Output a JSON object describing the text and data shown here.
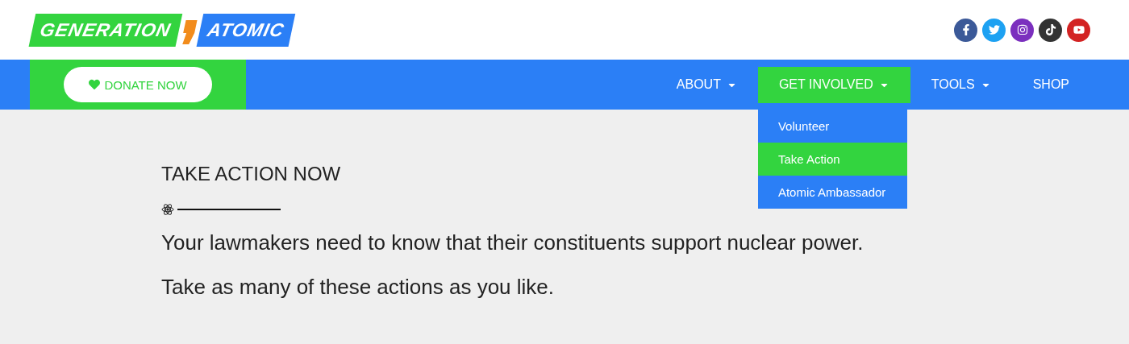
{
  "logo": {
    "left": "GENERATION",
    "right": "ATOMIC"
  },
  "social": [
    {
      "kind": "facebook",
      "color": "#3b5998"
    },
    {
      "kind": "twitter",
      "color": "#1da1f2"
    },
    {
      "kind": "instagram",
      "color": "#7b2fbe"
    },
    {
      "kind": "tiktok",
      "color": "#333333"
    },
    {
      "kind": "youtube",
      "color": "#d32323"
    }
  ],
  "donate": {
    "label": "DONATE NOW"
  },
  "nav": [
    {
      "label": "ABOUT",
      "dropdown": true,
      "selected": false
    },
    {
      "label": "GET INVOLVED",
      "dropdown": true,
      "selected": true,
      "expanded": true,
      "children": [
        {
          "label": "Volunteer",
          "selected": false
        },
        {
          "label": "Take Action",
          "selected": true
        },
        {
          "label": "Atomic Ambassador",
          "selected": false
        }
      ]
    },
    {
      "label": "TOOLS",
      "dropdown": true,
      "selected": false
    },
    {
      "label": "SHOP",
      "dropdown": false,
      "selected": false
    }
  ],
  "section": {
    "heading": "TAKE ACTION NOW",
    "paragraphs": [
      "Your lawmakers need to know that their constituents support nuclear power.",
      "Take as many of these actions as you like."
    ]
  }
}
